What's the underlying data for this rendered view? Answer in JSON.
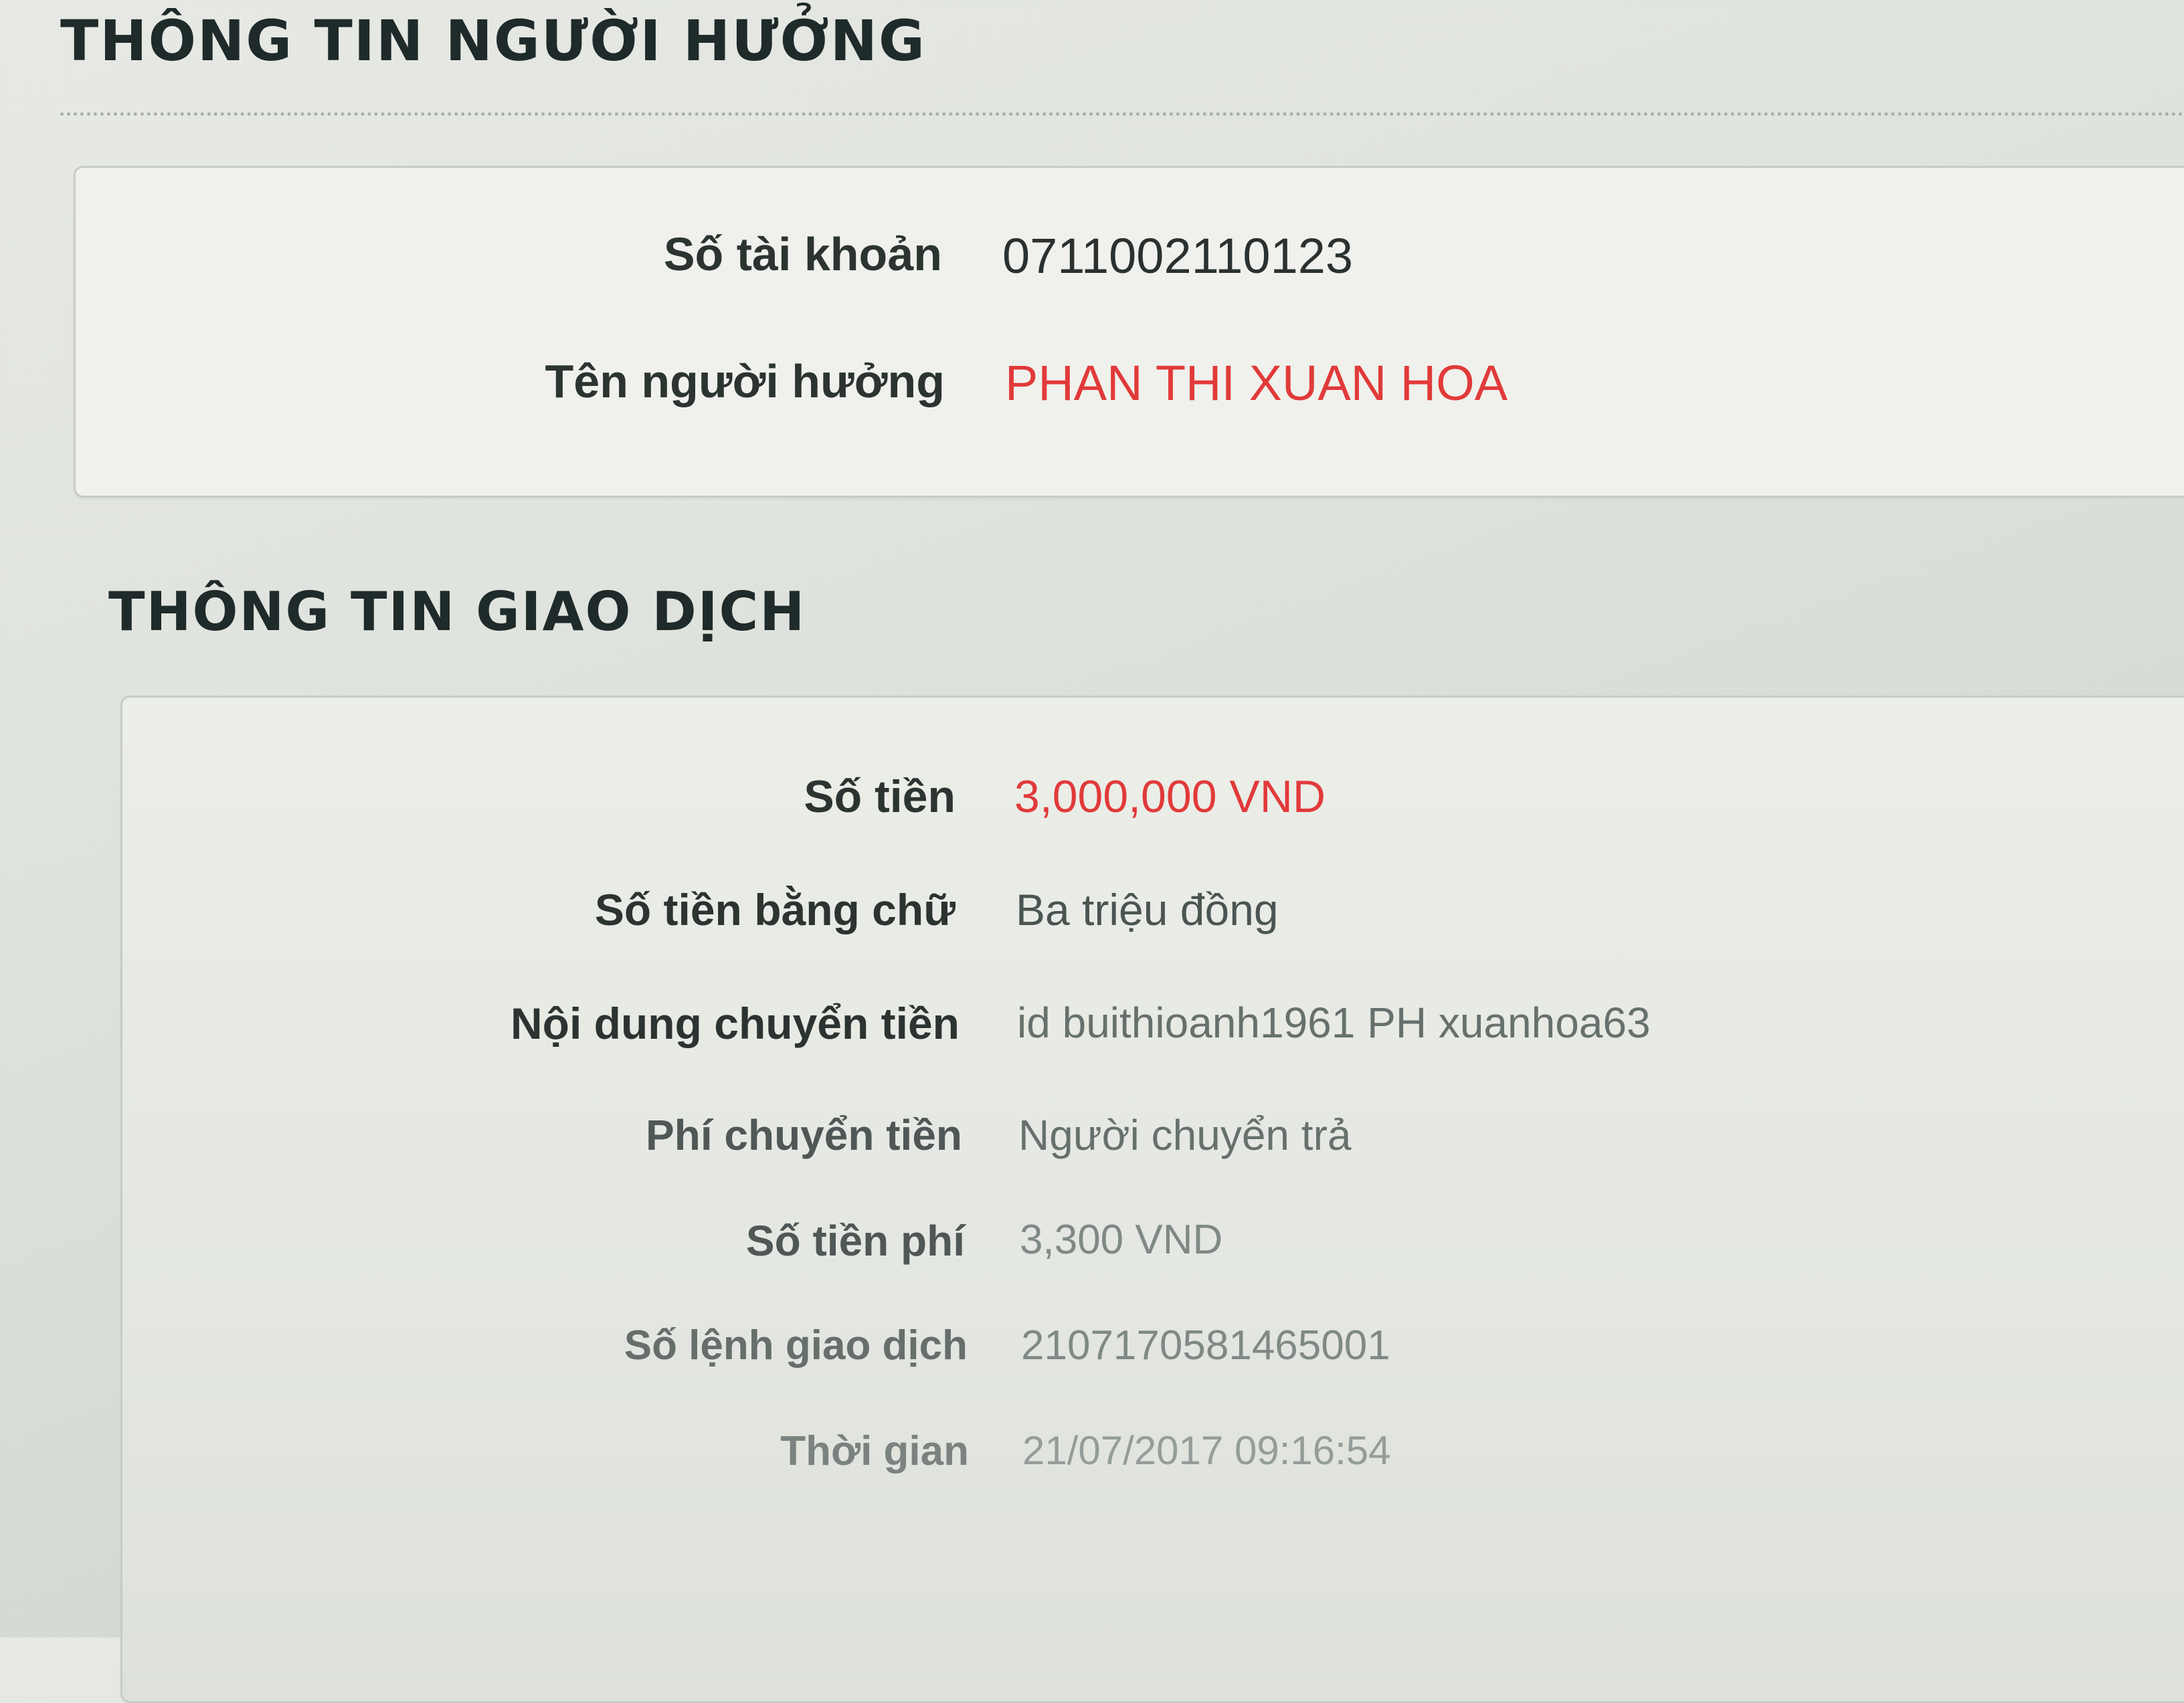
{
  "beneficiary_section": {
    "title": "THÔNG TIN NGƯỜI HƯỞNG",
    "fields": [
      {
        "label": "Số tài khoản",
        "value": "0711002110123"
      },
      {
        "label": "Tên người hưởng",
        "value": "PHAN THI XUAN HOA"
      }
    ]
  },
  "transaction_section": {
    "title": "THÔNG TIN GIAO DỊCH",
    "fields": [
      {
        "label": "Số tiền",
        "value": "3,000,000 VND"
      },
      {
        "label": "Số tiền bằng chữ",
        "value": "Ba triệu đồng"
      },
      {
        "label": "Nội dung chuyển tiền",
        "value": "id buithioanh1961 PH xuanhoa63"
      },
      {
        "label": "Phí chuyển tiền",
        "value": "Người chuyển trả"
      },
      {
        "label": "Số tiền phí",
        "value": "3,300 VND"
      },
      {
        "label": "Số lệnh giao dịch",
        "value": "2107170581465001"
      },
      {
        "label": "Thời gian",
        "value": "21/07/2017 09:16:54"
      }
    ]
  },
  "colors": {
    "highlight": "#e13a3a",
    "text": "#2c3432",
    "title": "#1f2a2a"
  }
}
